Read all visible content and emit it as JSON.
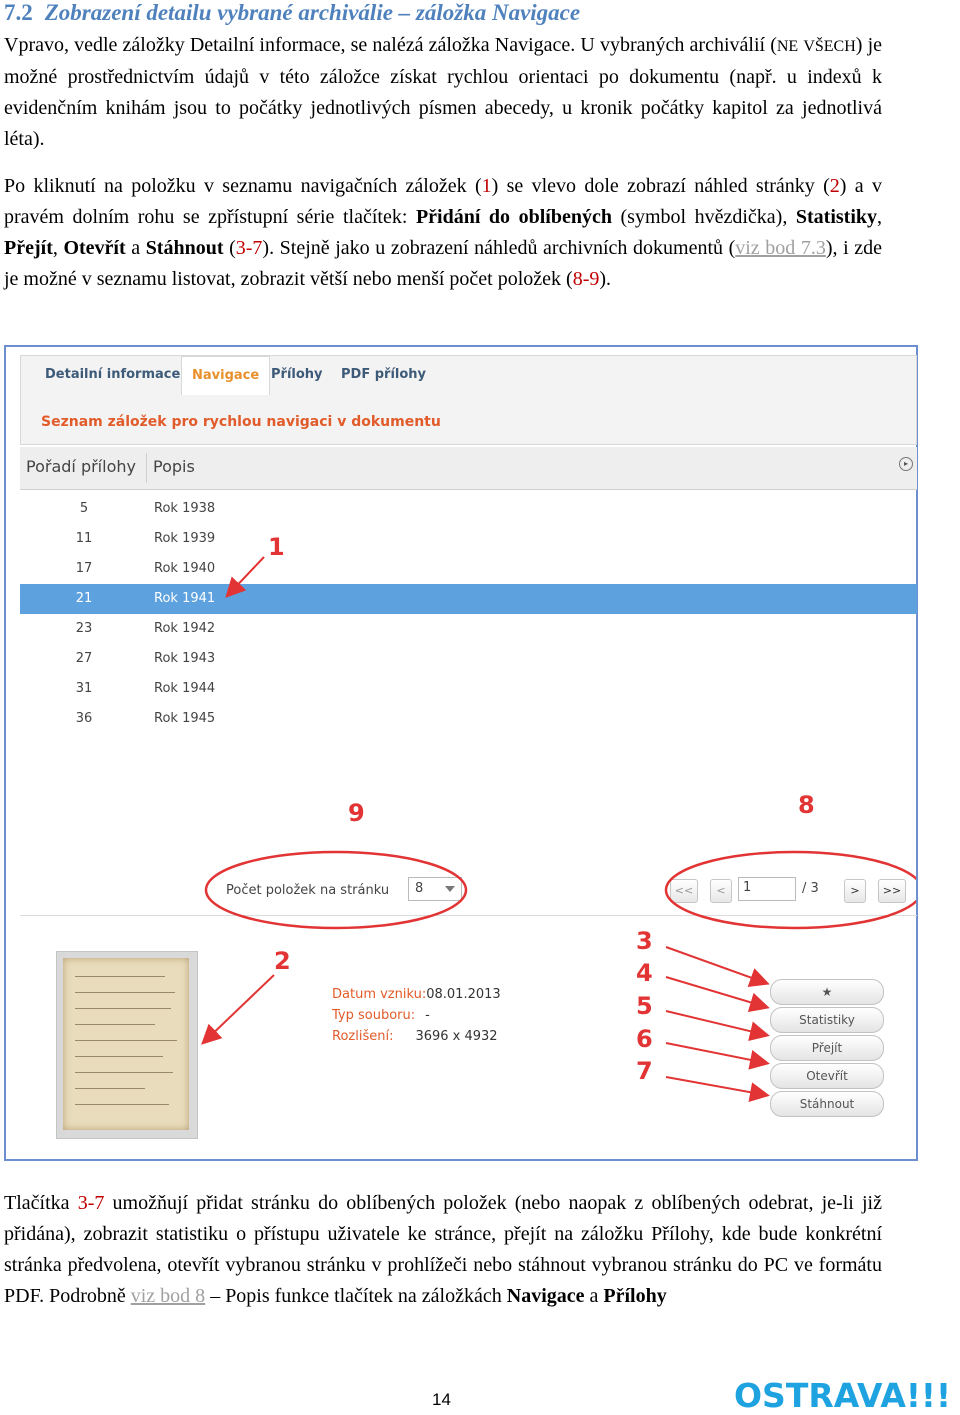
{
  "heading": {
    "number": "7.2",
    "title": "Zobrazení detailu vybrané archiválie – záložka Navigace"
  },
  "p1": {
    "a": "Vpravo, vedle záložky Detailní informace, se nalézá záložka Navigace. U vybraných archiválií (",
    "ne": "NE",
    "vsech": "VŠECH",
    "b": ") je možné prostřednictvím údajů v této záložce získat rychlou orientaci po dokumentu (např. u indexů k evidenčním knihám jsou to počátky jednotlivých písmen abecedy, u kronik počátky kapitol za jednotlivá léta)."
  },
  "p2": {
    "t1": "Po kliknutí na položku v seznamu navigačních záložek (",
    "n1": "1",
    "t2": ") se vlevo dole zobrazí náhled stránky (",
    "n2": "2",
    "t3": ") a v pravém dolním rohu se zpřístupní série tlačítek: ",
    "b1": "Přidání do oblíbených",
    "t4": " (symbol hvězdička), ",
    "b2": "Statistiky",
    "c1": ", ",
    "b3": "Přejít",
    "c2": ", ",
    "b4": "Otevřít",
    "t5": " a ",
    "b5": "Stáhnout",
    "t6": " (",
    "n3": "3-7",
    "t7": "). Stejně jako u zobrazení náhledů archivních dokumentů (",
    "link": "viz bod 7.3",
    "t8": "), i zde je možné v seznamu listovat, zobrazit větší nebo menší počet položek (",
    "n4": "8-9",
    "t9": ")."
  },
  "screenshot": {
    "tabs": [
      "Detailní informace",
      "Navigace",
      "Přílohy",
      "PDF přílohy"
    ],
    "subtitle": "Seznam záložek pro rychlou navigaci v dokumentu",
    "columns": [
      "Pořadí přílohy",
      "Popis"
    ],
    "rows": [
      {
        "order": "5",
        "desc": "Rok 1938"
      },
      {
        "order": "11",
        "desc": "Rok 1939"
      },
      {
        "order": "17",
        "desc": "Rok 1940"
      },
      {
        "order": "21",
        "desc": "Rok 1941"
      },
      {
        "order": "23",
        "desc": "Rok 1942"
      },
      {
        "order": "27",
        "desc": "Rok 1943"
      },
      {
        "order": "31",
        "desc": "Rok 1944"
      },
      {
        "order": "36",
        "desc": "Rok 1945"
      }
    ],
    "selected_row": 3,
    "pager": {
      "label": "Počet položek na stránku",
      "per_page": "8",
      "first": "<<",
      "prev": "<",
      "current_page": "1",
      "of": "/ 3",
      "next": ">",
      "last": ">>"
    },
    "meta": {
      "date_label": "Datum vzniku:",
      "date_value": "08.01.2013",
      "type_label": "Typ souboru:",
      "type_value": "-",
      "res_label": "Rozlišení:",
      "res_value": "3696 x 4932"
    },
    "actions": [
      "★",
      "Statistiky",
      "Přejít",
      "Otevřít",
      "Stáhnout"
    ],
    "callouts": {
      "c1": "1",
      "c2": "2",
      "c3": "3",
      "c4": "4",
      "c5": "5",
      "c6": "6",
      "c7": "7",
      "c8": "8",
      "c9": "9"
    },
    "annotation_color": "#e23434"
  },
  "p3": {
    "t1": "Tlačítka ",
    "n1": "3-7",
    "t2": " umožňují přidat stránku do oblíbených položek (nebo naopak z oblíbených odebrat, je-li již přidána), zobrazit statistiku o přístupu uživatele ke stránce, přejít na záložku Přílohy, kde bude konkrétní stránka předvolena, otevřít vybranou stránku v prohlížeči nebo stáhnout vybranou stránku do PC ve formátu PDF. Podrobně ",
    "link": "viz bod 8",
    "t3": " – Popis funkce tlačítek na záložkách ",
    "b1": "Navigace",
    "t4": " a ",
    "b2": "Přílohy"
  },
  "footer": {
    "page": "14",
    "logo": "OSTRAVA!!!"
  }
}
